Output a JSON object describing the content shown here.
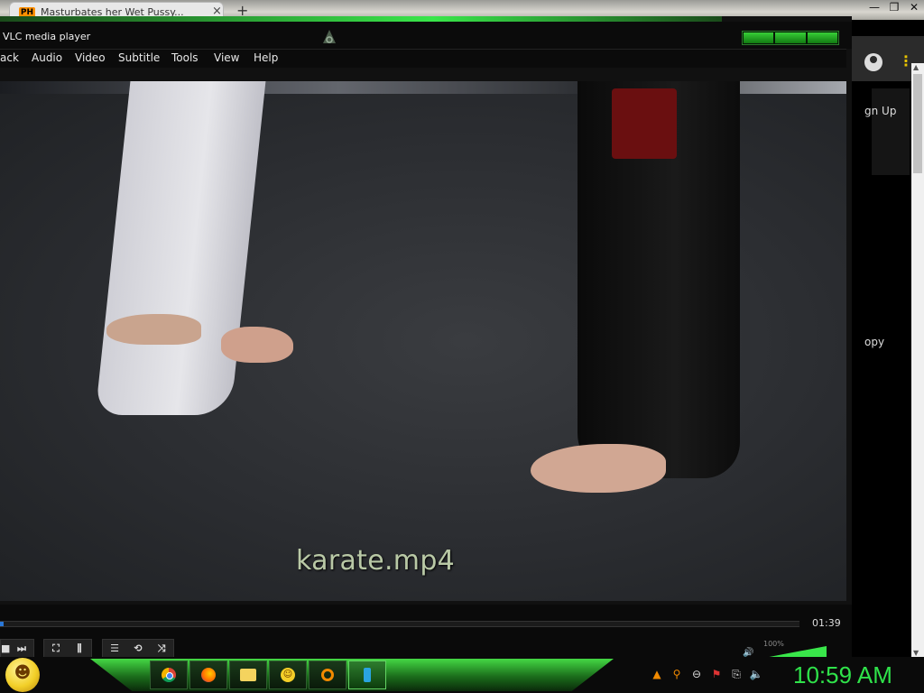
{
  "browser": {
    "tab_favicon": "PH",
    "tab_title": "Masturbates her Wet Pussy...",
    "tab_close": "×",
    "new_tab": "+",
    "minimize": "—",
    "restore": "❐",
    "close": "✕",
    "signup_label": "gn Up",
    "copy_text": "opy",
    "menu_dots": "⋮",
    "scroll_up": "▲",
    "scroll_down": "▼"
  },
  "vlc": {
    "title": "VLC media player",
    "menu": [
      "ack",
      "Audio",
      "Video",
      "Subtitle",
      "Tools",
      "View",
      "Help"
    ],
    "caption": "karate.mp4",
    "time": "01:39",
    "progress": 0.005,
    "volume_label": "100%",
    "volume_level": 1.0,
    "accent_color": "#39e64a",
    "seek_color": "#2a78d8",
    "buttons": {
      "stop": "■",
      "next": "⏭",
      "fullscreen": "⛶",
      "extended": "⫼",
      "playlist": "☰",
      "loop": "⟲",
      "shuffle": "⤨",
      "volume_icon": "🔊"
    }
  },
  "taskbar": {
    "clock": "10:59 AM",
    "orb_face": "☻",
    "smiley_face": "☺",
    "tray": {
      "vlc": "▲",
      "search": "⚲",
      "minus": "⊖",
      "flag": "⚑",
      "network": "⎘",
      "speaker": "🔈"
    }
  }
}
